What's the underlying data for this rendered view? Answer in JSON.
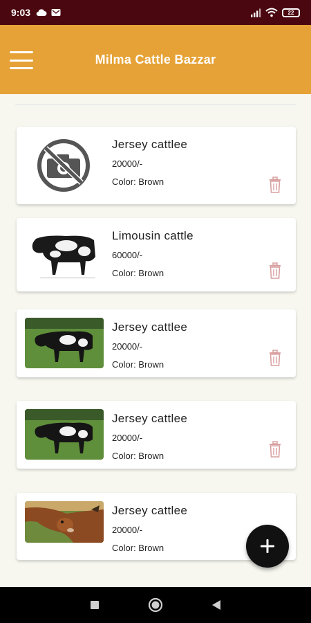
{
  "status_bar": {
    "time": "9:03",
    "battery": "22"
  },
  "app_bar": {
    "title": "Milma Cattle Bazzar"
  },
  "listings": [
    {
      "title": "Jersey cattlee",
      "price": "20000/-",
      "color": "Color: Brown",
      "image": "no-photo-icon"
    },
    {
      "title": "Limousin cattle",
      "price": "60000/-",
      "color": "Color: Brown",
      "image": "holstein-cow-white-background"
    },
    {
      "title": "Jersey cattlee",
      "price": "20000/-",
      "color": "Color: Brown",
      "image": "holstein-cow-on-grass"
    },
    {
      "title": "Jersey cattlee",
      "price": "20000/-",
      "color": "Color: Brown",
      "image": "holstein-cow-on-grass"
    },
    {
      "title": "Jersey cattlee",
      "price": "20000/-",
      "color": "Color: Brown",
      "image": "brown-cow-closeup"
    }
  ],
  "colors": {
    "status_bar": "#4a0710",
    "app_bar": "#e6a236",
    "delete_icon": "#d9a0a0",
    "fab": "#111111"
  }
}
